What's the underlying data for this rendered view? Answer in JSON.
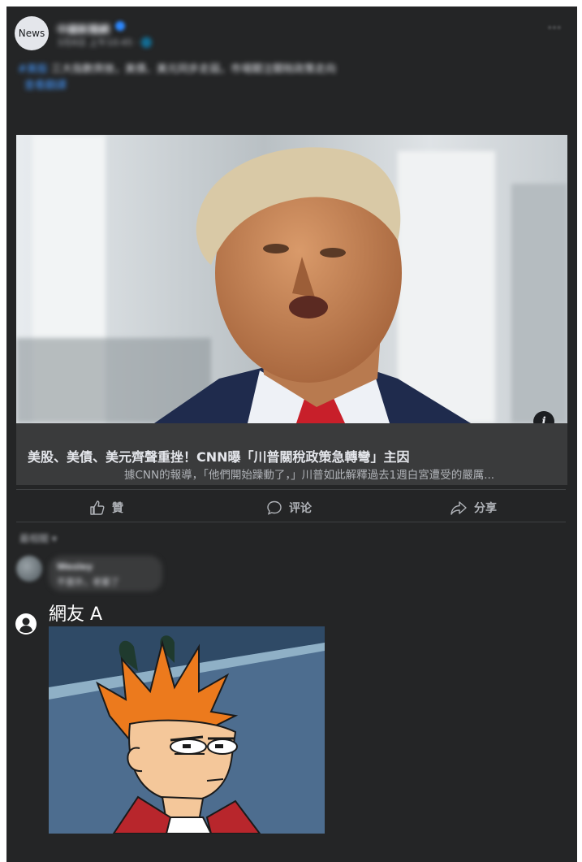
{
  "post": {
    "avatar_label": "News",
    "page_name": "中國新聞網",
    "timestamp": "3月8日 上午10:45 · 🌐",
    "more_icon": "more-horizontal-icon",
    "text_hashtag": "#美股",
    "text_body": " 三大指數齊挫，美債、美元同步走弱，市場關注關稅政策走向",
    "translate_link": "查看翻譯",
    "photo_subject": "trump-portrait",
    "link": {
      "headline": "美股、美債、美元齊聲重挫！CNN曝「川普關稅政策急轉彎」主因",
      "description": "據CNN的報導，「他們開始躁動了，」川普如此解釋過去1週白宮遭受的嚴厲..."
    },
    "actions": {
      "like": "贊",
      "comment": "评论",
      "share": "分享"
    }
  },
  "comments": {
    "sort_label": "最相關 ▾",
    "first": {
      "name": "Wesley",
      "text": "不意外，老套了"
    },
    "user_comment": {
      "name": "網友 A",
      "image": "fry-squint-meme"
    }
  },
  "colors": {
    "card_bg": "#242526",
    "link_bg": "#3a3b3c",
    "accent": "#4599ff"
  }
}
